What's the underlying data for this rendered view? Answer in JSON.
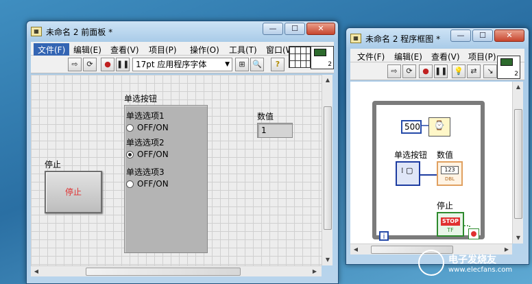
{
  "front_panel": {
    "title": "未命名 2 前面板 *",
    "title_icon": "labview-vi-icon",
    "window_buttons": [
      "—",
      "☐",
      "✕"
    ],
    "menu": [
      "文件(F)",
      "编辑(E)",
      "查看(V)",
      "项目(P)",
      "操作(O)",
      "工具(T)",
      "窗口(W"
    ],
    "toolbar": {
      "buttons": [
        "run-arrow-icon",
        "run-continuous-icon",
        "abort-icon",
        "pause-icon",
        "align-icon",
        "search-icon",
        "help-icon"
      ],
      "font": "17pt 应用程序字体"
    },
    "connector_num": "2",
    "stop_label": "停止",
    "stop_button_text": "停止",
    "radio": {
      "label": "单选按钮",
      "options": [
        {
          "title": "单选选项1",
          "text": "OFF/ON",
          "selected": false
        },
        {
          "title": "单选选项2",
          "text": "OFF/ON",
          "selected": true
        },
        {
          "title": "单选选项3",
          "text": "OFF/ON",
          "selected": false
        }
      ]
    },
    "numeric": {
      "label": "数值",
      "value": "1"
    }
  },
  "block_diagram": {
    "title": "未命名 2 程序框图 *",
    "window_buttons": [
      "—",
      "☐",
      "✕"
    ],
    "menu": [
      "文件(F)",
      "编辑(E)",
      "查看(V)",
      "项目(P)"
    ],
    "connector_num": "2",
    "wait_constant": "500",
    "radio_label": "单选按钮",
    "numeric_label": "数值",
    "numeric_type": "123",
    "numeric_dtype": "DBL",
    "stop_label": "停止",
    "stop_text": "STOP",
    "stop_type": "TF",
    "iteration": "i"
  },
  "watermark": {
    "cn": "电子发烧友",
    "en": "www.elecfans.com"
  },
  "colors": {
    "wire_orange": "#e07a1a",
    "wire_blue": "#1c3ba0",
    "wire_green": "#2d8a2d",
    "stop_red": "#e03030"
  }
}
